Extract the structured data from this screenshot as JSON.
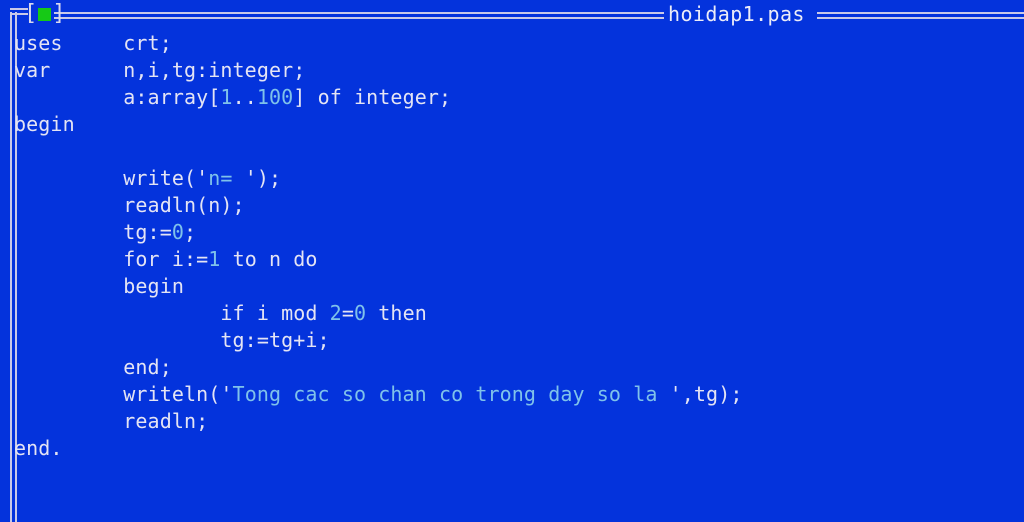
{
  "window": {
    "title": "hoidap1.pas",
    "close_widget": {
      "left_bracket": "[",
      "right_bracket": "]",
      "box_icon": "green-square-icon"
    }
  },
  "colors": {
    "background": "#0433dc",
    "border": "#c9c9e8",
    "text": "#e4e4f4",
    "literal": "#7fc2ea",
    "close_box": "#16c916"
  },
  "editor": {
    "language": "pascal",
    "filename": "hoidap1.pas",
    "lines": [
      {
        "n": 1,
        "indent": 0,
        "segments": [
          {
            "t": "uses     crt;",
            "k": "plain"
          }
        ]
      },
      {
        "n": 2,
        "indent": 0,
        "segments": [
          {
            "t": "var      n,i,tg:integer;",
            "k": "plain"
          }
        ]
      },
      {
        "n": 3,
        "indent": 0,
        "segments": [
          {
            "t": "         a:array[",
            "k": "plain"
          },
          {
            "t": "1",
            "k": "lit"
          },
          {
            "t": "..",
            "k": "plain"
          },
          {
            "t": "100",
            "k": "lit"
          },
          {
            "t": "] of integer;",
            "k": "plain"
          }
        ]
      },
      {
        "n": 4,
        "indent": 0,
        "segments": [
          {
            "t": "begin",
            "k": "plain"
          }
        ]
      },
      {
        "n": 5,
        "indent": 0,
        "segments": [
          {
            "t": "",
            "k": "plain"
          }
        ]
      },
      {
        "n": 6,
        "indent": 0,
        "segments": [
          {
            "t": "         write('",
            "k": "plain"
          },
          {
            "t": "n= ",
            "k": "lit"
          },
          {
            "t": "');",
            "k": "plain"
          }
        ]
      },
      {
        "n": 7,
        "indent": 0,
        "segments": [
          {
            "t": "         readln(n);",
            "k": "plain"
          }
        ]
      },
      {
        "n": 8,
        "indent": 0,
        "segments": [
          {
            "t": "         tg:=",
            "k": "plain"
          },
          {
            "t": "0",
            "k": "lit"
          },
          {
            "t": ";",
            "k": "plain"
          }
        ]
      },
      {
        "n": 9,
        "indent": 0,
        "segments": [
          {
            "t": "         for i:=",
            "k": "plain"
          },
          {
            "t": "1",
            "k": "lit"
          },
          {
            "t": " to n do",
            "k": "plain"
          }
        ]
      },
      {
        "n": 10,
        "indent": 0,
        "segments": [
          {
            "t": "         begin",
            "k": "plain"
          }
        ]
      },
      {
        "n": 11,
        "indent": 0,
        "segments": [
          {
            "t": "                 if i mod ",
            "k": "plain"
          },
          {
            "t": "2",
            "k": "lit"
          },
          {
            "t": "=",
            "k": "plain"
          },
          {
            "t": "0",
            "k": "lit"
          },
          {
            "t": " then",
            "k": "plain"
          }
        ]
      },
      {
        "n": 12,
        "indent": 0,
        "segments": [
          {
            "t": "                 tg:=tg+i;",
            "k": "plain"
          }
        ]
      },
      {
        "n": 13,
        "indent": 0,
        "segments": [
          {
            "t": "         end;",
            "k": "plain"
          }
        ]
      },
      {
        "n": 14,
        "indent": 0,
        "segments": [
          {
            "t": "         writeln('",
            "k": "plain"
          },
          {
            "t": "Tong cac so chan co trong day so la ",
            "k": "lit"
          },
          {
            "t": "',tg);",
            "k": "plain"
          }
        ]
      },
      {
        "n": 15,
        "indent": 0,
        "segments": [
          {
            "t": "         readln;",
            "k": "plain"
          }
        ]
      },
      {
        "n": 16,
        "indent": 0,
        "segments": [
          {
            "t": "end.",
            "k": "plain"
          }
        ]
      }
    ]
  }
}
